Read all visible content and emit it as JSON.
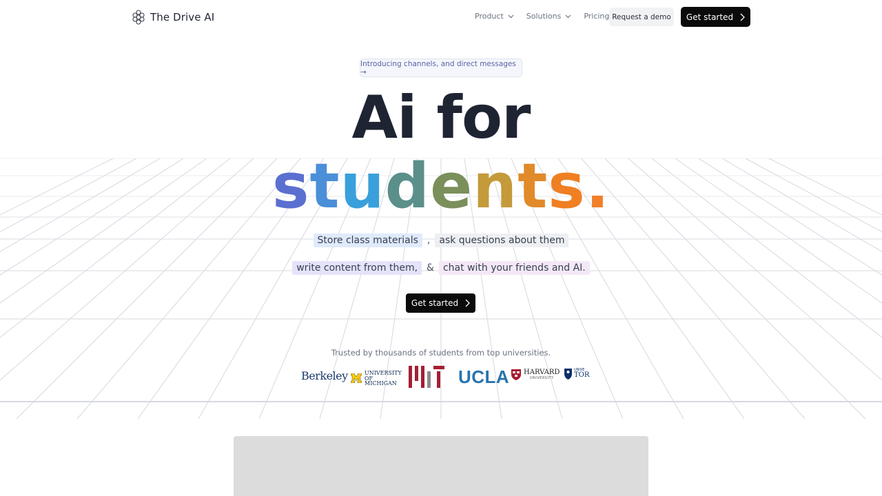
{
  "brand": {
    "name": "The Drive AI",
    "logo_icon": "brain-icon"
  },
  "nav": {
    "links": [
      {
        "label": "Product",
        "has_dropdown": true
      },
      {
        "label": "Solutions",
        "has_dropdown": true
      },
      {
        "label": "Pricing",
        "has_dropdown": false
      }
    ],
    "request_demo_label": "Request a demo",
    "get_started_label": "Get started"
  },
  "hero": {
    "announcement": "Introducing channels, and direct messages →",
    "title_line1": "Ai for",
    "title_line2": "students.",
    "title_line2_colors": [
      "#5a6fd0",
      "#4b8fd8",
      "#3aa0db",
      "#5a8f8a",
      "#7a8f5a",
      "#c49a3a",
      "#e08a2a",
      "#ef7f22",
      "#f0802a"
    ],
    "features_row1": [
      {
        "text": "Store class materials",
        "style": "blue"
      },
      {
        "text": ",",
        "style": "sep"
      },
      {
        "text": "ask questions about them",
        "style": "gray"
      }
    ],
    "features_row2": [
      {
        "text": "write content from them,",
        "style": "lav"
      },
      {
        "text": "&",
        "style": "sep"
      },
      {
        "text": "chat with your friends and AI.",
        "style": "pink"
      }
    ],
    "cta_label": "Get started"
  },
  "trusted": {
    "text": "Trusted by thousands of students from top universities.",
    "logos": [
      {
        "name": "berkeley-logo",
        "text": "Berkeley"
      },
      {
        "name": "michigan-logo",
        "text": "UNIVERSITY OF MICHIGAN"
      },
      {
        "name": "mit-logo",
        "text": "MIT"
      },
      {
        "name": "ucla-logo",
        "text": "UCLA"
      },
      {
        "name": "harvard-logo",
        "text": "HARVARD",
        "subtext": "UNIVERSITY"
      },
      {
        "name": "toronto-logo",
        "text": "TOR",
        "subtext": "UNIVE"
      }
    ]
  },
  "colors": {
    "dark": "#1f2433",
    "button_bg": "#0b0b0c",
    "pill_text": "#5b63a6",
    "preview_bg": "#dcdcdc"
  }
}
